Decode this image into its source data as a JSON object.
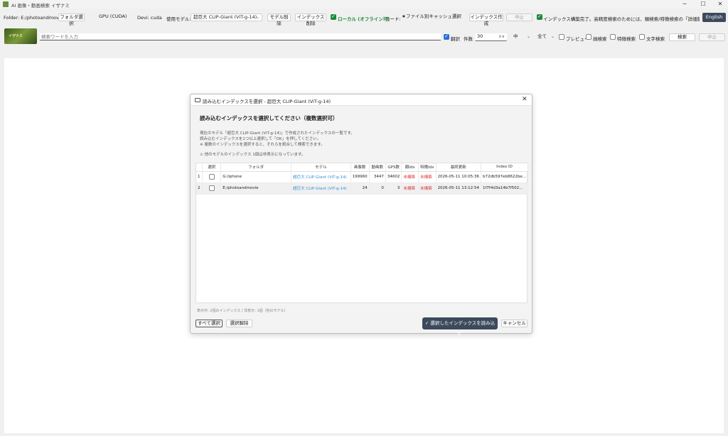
{
  "window": {
    "title": "AI 画像・動画検索 イザナミ",
    "minimize": "─",
    "maximize": "☐",
    "close": "✕"
  },
  "toolbar": {
    "folder_label": "Folder: E:/photoandmovie",
    "folder_select": "フォルダ選択",
    "gpu": "GPU (CUDA)",
    "device": "Devi: cuda",
    "model_label": "使用モデル:",
    "model_value": "超巨大 CLIP-Giant (ViT-g-14)",
    "model_delete": "モデル削除",
    "index_delete": "インデックス削除",
    "local_label": "ローカル (オフライン可)",
    "mode_label": "モード:",
    "mode_value": "★ファイル別キャッシュ選択",
    "index_create": "インデックス作成",
    "stop": "中止",
    "status": "インデックス構築完了。高精度検索のためには、類検索/特徴検索の「詳細版類検索用",
    "english": "English"
  },
  "search": {
    "logo_text": "イザナミ",
    "placeholder": "検索ワードを入力",
    "translate_label": "翻訳",
    "count_label": "件数",
    "count_value": "30",
    "size_value": "中",
    "filter_value": "全て",
    "preview_label": "プレビュー",
    "face_label": "顔検索",
    "feature_label": "特徴検索",
    "text_label": "文字検索",
    "search_button": "検索",
    "stop_button": "中止"
  },
  "dialog": {
    "title": "読み込むインデックスを選択 - 超巨大 CLIP-Giant (ViT-g-14)",
    "close": "✕",
    "heading": "読み込むインデックスを選択してください（複数選択可）",
    "desc1": "現在のモデル「超巨大 CLIP-Giant (ViT-g-14)」で作成されたインデックスの一覧です。",
    "desc2": "読み込むインデックスを1つ以上選択して「OK」を押してください。",
    "desc3": "※ 複数のインデックスを選択すると、それらを統合して検索できます。",
    "desc4": "⚠ 他のモデルのインデックス 1個は非表示になっています。",
    "columns": [
      "選択",
      "フォルダ",
      "モデル",
      "画像数",
      "動画数",
      "GPS数",
      "顔Idx",
      "特徴Idx",
      "最終更新",
      "Index ID"
    ],
    "rows": [
      {
        "n": "1",
        "folder": "G:/iphone",
        "model": "超巨大 CLIP-Giant (ViT-g-14)",
        "images": "199960",
        "videos": "3447",
        "gps": "34602",
        "face": "未構築",
        "feature": "未構築",
        "updated": "2026-05-11 10:05:36",
        "id": "b72db597eb8622be..."
      },
      {
        "n": "2",
        "folder": "E:/photoandmovie",
        "model": "超巨大 CLIP-Giant (ViT-g-14)",
        "images": "24",
        "videos": "0",
        "gps": "3",
        "face": "未構築",
        "feature": "未構築",
        "updated": "2026-05-11 13:12:54",
        "id": "1f7f4d3a14b7f502..."
      }
    ],
    "footnote": "表示中: 2個のインデックス / 非表示: 1個（他のモデル）",
    "select_all": "すべて選択",
    "deselect": "選択解除",
    "load": "✓ 選択したインデックスを読み込む",
    "cancel": "キャンセル"
  },
  "colors": {
    "accent": "#3d4a5c",
    "link": "#2e8fd6",
    "warning": "#d83b3b",
    "check": "#1a8a3a"
  },
  "icons": [
    "app-icon",
    "folder-icon",
    "close-icon",
    "chevron-down-icon",
    "check-icon"
  ]
}
